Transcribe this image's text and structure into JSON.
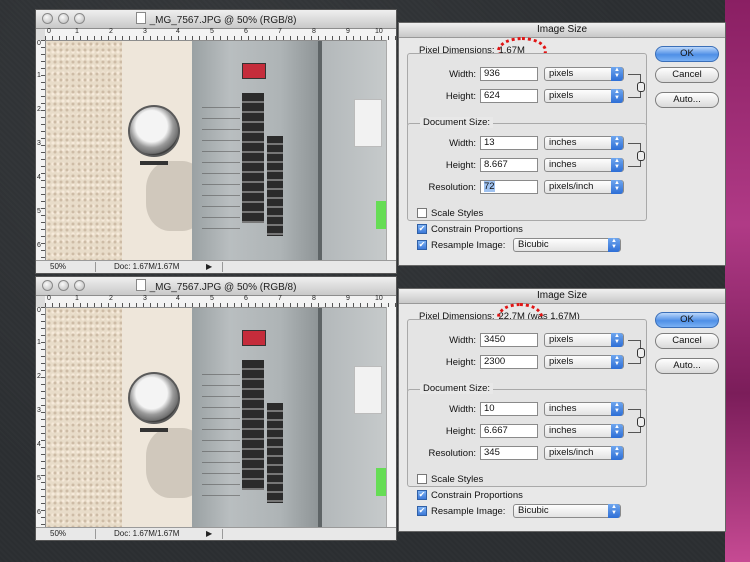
{
  "top": {
    "doc_window": {
      "title": "_MG_7567.JPG @ 50% (RGB/8)",
      "zoom": "50%",
      "doc_info": "Doc: 1.67M/1.67M"
    },
    "dialog": {
      "title": "Image Size",
      "pixel_dimensions_label": "Pixel Dimensions:",
      "pixel_dimensions_size": "1.67M",
      "px_width_label": "Width:",
      "px_width": "936",
      "px_width_unit": "pixels",
      "px_height_label": "Height:",
      "px_height": "624",
      "px_height_unit": "pixels",
      "doc_size_label": "Document Size:",
      "doc_width_label": "Width:",
      "doc_width": "13",
      "doc_width_unit": "inches",
      "doc_height_label": "Height:",
      "doc_height": "8.667",
      "doc_height_unit": "inches",
      "resolution_label": "Resolution:",
      "resolution": "72",
      "resolution_unit": "pixels/inch",
      "scale_styles": "Scale Styles",
      "scale_styles_checked": false,
      "constrain": "Constrain Proportions",
      "constrain_checked": true,
      "resample": "Resample Image:",
      "resample_checked": true,
      "resample_method": "Bicubic",
      "ok": "OK",
      "cancel": "Cancel",
      "auto": "Auto..."
    }
  },
  "bottom": {
    "doc_window": {
      "title": "_MG_7567.JPG @ 50% (RGB/8)",
      "zoom": "50%",
      "doc_info": "Doc: 1.67M/1.67M"
    },
    "dialog": {
      "title": "Image Size",
      "pixel_dimensions_label": "Pixel Dimensions:",
      "pixel_dimensions_size": "22.7M (was 1.67M)",
      "px_width_label": "Width:",
      "px_width": "3450",
      "px_width_unit": "pixels",
      "px_height_label": "Height:",
      "px_height": "2300",
      "px_height_unit": "pixels",
      "doc_size_label": "Document Size:",
      "doc_width_label": "Width:",
      "doc_width": "10",
      "doc_width_unit": "inches",
      "doc_height_label": "Height:",
      "doc_height": "6.667",
      "doc_height_unit": "inches",
      "resolution_label": "Resolution:",
      "resolution": "345",
      "resolution_unit": "pixels/inch",
      "scale_styles": "Scale Styles",
      "scale_styles_checked": false,
      "constrain": "Constrain Proportions",
      "constrain_checked": true,
      "resample": "Resample Image:",
      "resample_checked": true,
      "resample_method": "Bicubic",
      "ok": "OK",
      "cancel": "Cancel",
      "auto": "Auto..."
    }
  },
  "colors": {
    "highlight_circle": "#e01515",
    "ok_button": "#4f8fe6",
    "selection": "#9fc2f0",
    "side_accent": "#b03a86"
  }
}
